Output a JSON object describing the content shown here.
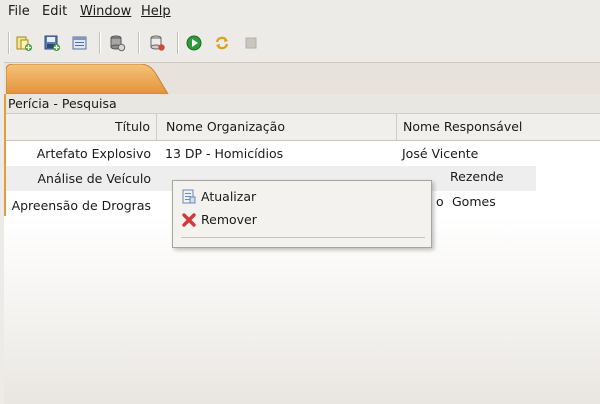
{
  "menu": {
    "file": "File",
    "edit": "Edit",
    "window": "Window",
    "help": "Help"
  },
  "toolbar": {
    "icons": [
      "new-folder-icon",
      "save-icon",
      "properties-icon",
      "database-icon",
      "database-add-icon",
      "run-icon",
      "refresh-icon",
      "stop-icon"
    ]
  },
  "panel": {
    "title": "Perícia - Pesquisa"
  },
  "table": {
    "headers": [
      "Título",
      "Nome Organização",
      "Nome Responsável"
    ],
    "rows": [
      [
        "Artefato Explosivo",
        "13 DP - Homicídios",
        "José Vicente"
      ],
      [
        "Análise de Veículo",
        "",
        "Rezende"
      ],
      [
        "Apreensão de Drogras",
        "",
        "Gomes"
      ]
    ],
    "row3_prefix": "o"
  },
  "context_menu": {
    "items": [
      {
        "label": "Atualizar",
        "icon": "refresh-doc-icon"
      },
      {
        "label": "Remover",
        "icon": "red-x-icon"
      }
    ]
  },
  "colors": {
    "accent_tab": "#e59c3c",
    "window_bg": "#ecebe8"
  }
}
